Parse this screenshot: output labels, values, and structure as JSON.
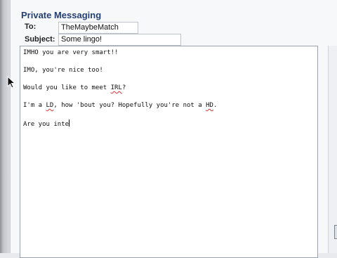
{
  "header": {
    "title": "Private Messaging"
  },
  "compose": {
    "to_label": "To:",
    "to_value": "TheMaybeMatch",
    "subject_label": "Subject:",
    "subject_value": "Some lingo!"
  },
  "message": {
    "line1": "IMHO you are very smart!!",
    "line2": "IMO, you're nice too!",
    "line3_pre": "Would you like to meet ",
    "line3_word": "IRL",
    "line3_post": "?",
    "line4_pre": "I'm a ",
    "line4_word1": "LD",
    "line4_mid": ", how 'bout you? Hopefully you're not a ",
    "line4_word2": "HD",
    "line4_post": ".",
    "line5": "Are you inte"
  },
  "icons": {
    "cursor": "mouse-pointer-icon"
  }
}
